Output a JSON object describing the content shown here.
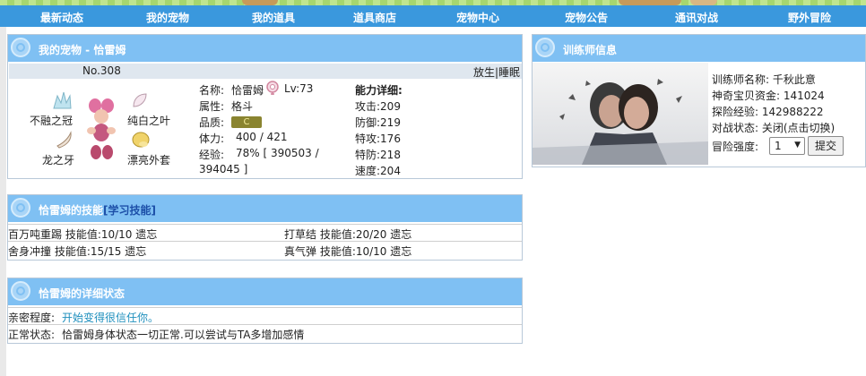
{
  "nav": [
    "最新动态",
    "我的宠物",
    "我的道具",
    "道具商店",
    "宠物中心",
    "宠物公告",
    "通讯对战",
    "野外冒险"
  ],
  "pet_panel": {
    "title": "我的宠物 - 恰雷姆",
    "number": "No.308",
    "actions": "放生|睡眠",
    "items": [
      "不融之冠",
      "纯白之叶",
      "龙之牙",
      "漂亮外套"
    ],
    "info": {
      "name_label": "名称:",
      "name": "恰雷姆",
      "level": "Lv:73",
      "type_label": "属性:",
      "type": "格斗",
      "quality_label": "品质:",
      "quality": "C",
      "hp_label": "体力:",
      "hp": "400 / 421",
      "exp_label": "经验:",
      "exp_line1": "78% [ 390503 /",
      "exp_line2": "394045 ]"
    },
    "stats": {
      "heading": "能力详细:",
      "rows": [
        "攻击:209",
        "防御:219",
        "特攻:176",
        "特防:218",
        "速度:204"
      ]
    }
  },
  "skills_panel": {
    "title": "恰雷姆的技能",
    "learn": "[学习技能]",
    "rows": [
      [
        "百万吨重踢 技能值:10/10 遗忘",
        "打草结 技能值:20/20 遗忘"
      ],
      [
        "舍身冲撞 技能值:15/15 遗忘",
        "真气弹 技能值:10/10 遗忘"
      ]
    ]
  },
  "status_panel": {
    "title": "恰雷姆的详细状态",
    "intimacy_label": "亲密程度:",
    "intimacy_value": "开始变得很信任你。",
    "normal_label": "正常状态:",
    "normal_value": "恰雷姆身体状态一切正常.可以尝试与TA多增加感情"
  },
  "trainer_panel": {
    "title": "训练师信息",
    "name_line": "训练师名称: 千秋此意",
    "money_line": "神奇宝贝资金: 141024",
    "exp_line": "探险经验: 142988222",
    "battle_line": "对战状态: 关闭(点击切换)",
    "intensity_label": "冒险强度:",
    "intensity_value": "1",
    "submit": "提交"
  },
  "colors": {
    "nav": "#3a98dd",
    "panel_head": "#7fc0f3",
    "link": "#1e8fbd",
    "badge": "#8a8430"
  }
}
